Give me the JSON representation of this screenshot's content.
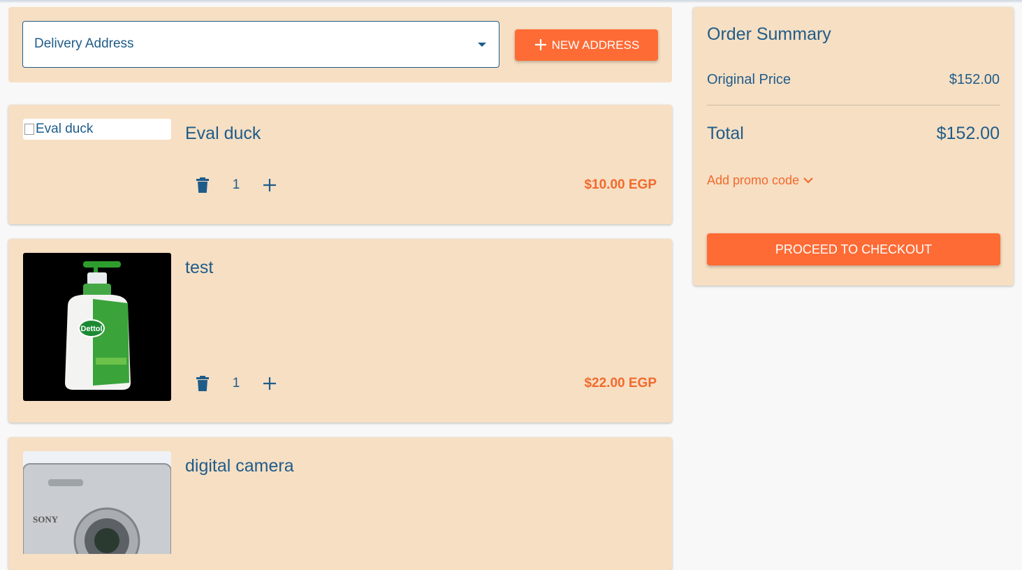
{
  "address": {
    "select_label": "Delivery Address",
    "new_address_label": "NEW ADDRESS"
  },
  "items": [
    {
      "title": "Eval duck",
      "image_alt": "Eval duck",
      "quantity": "1",
      "price": "$10.00 EGP"
    },
    {
      "title": "test",
      "quantity": "1",
      "price": "$22.00 EGP",
      "image_brand_text": "Dettol"
    },
    {
      "title": "digital camera",
      "image_brand_text": "SONY"
    }
  ],
  "summary": {
    "title": "Order Summary",
    "original_price_label": "Original Price",
    "original_price_value": "$152.00",
    "total_label": "Total",
    "total_value": "$152.00",
    "promo_label": "Add promo code",
    "checkout_label": "PROCEED TO CHECKOUT"
  },
  "colors": {
    "card_bg": "#f6dfc3",
    "accent": "#ff6b35",
    "text": "#1f5c8a",
    "price": "#f26a2e"
  }
}
